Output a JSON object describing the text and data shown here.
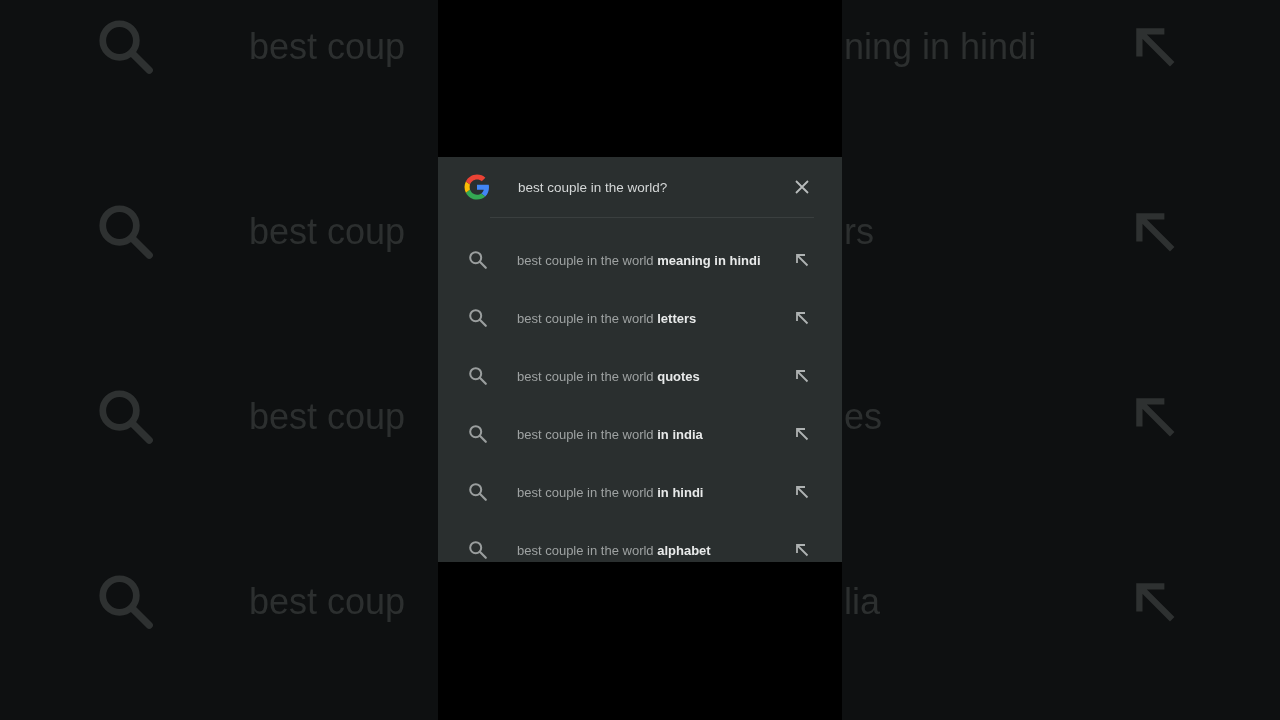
{
  "backdrop": {
    "left_rows": [
      {
        "text": "best coup"
      },
      {
        "text": "best coup"
      },
      {
        "text": "best coup"
      },
      {
        "text": "best coup"
      }
    ],
    "right_rows": [
      {
        "text": "ning in hindi"
      },
      {
        "text": "rs"
      },
      {
        "text": "es"
      },
      {
        "text": "lia"
      }
    ]
  },
  "search": {
    "query": "best couple in the world?"
  },
  "suggestions": [
    {
      "prefix": "best couple in the world",
      "completion": "meaning in hindi"
    },
    {
      "prefix": "best couple in the world",
      "completion": "letters"
    },
    {
      "prefix": "best couple in the world",
      "completion": "quotes"
    },
    {
      "prefix": "best couple in the world",
      "completion": "in india"
    },
    {
      "prefix": "best couple in the world",
      "completion": "in hindi"
    },
    {
      "prefix": "best couple in the world",
      "completion": "alphabet"
    }
  ]
}
